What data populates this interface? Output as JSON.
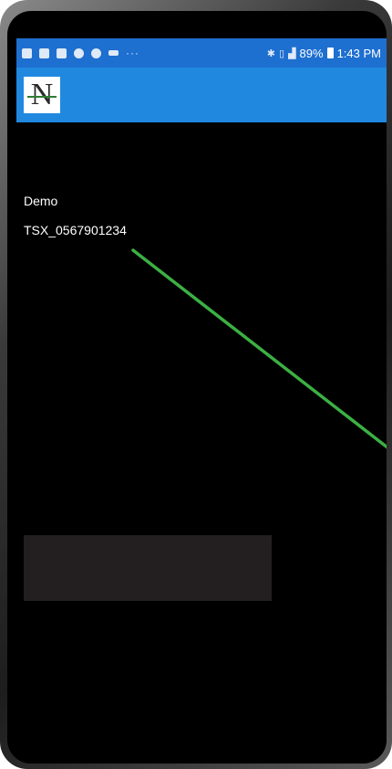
{
  "status_bar": {
    "battery": "89%",
    "time": "1:43 PM",
    "icons_left": [
      "flipboard-icon",
      "flipboard-icon",
      "message-icon",
      "chrome-icon",
      "app-icon",
      "photos-icon",
      "more-dots-icon"
    ],
    "icons_right": [
      "bluetooth-icon",
      "vibrate-icon",
      "signal-icon",
      "battery-icon"
    ],
    "more_dots": "···"
  },
  "app_bar": {
    "logo_text": "N",
    "color": "#2188e0"
  },
  "content": {
    "label": "Demo",
    "value": "TSX_0567901234"
  },
  "colors": {
    "screen_bg": "#000000",
    "status_bar": "#1d6fd0",
    "annotation_line": "#3cb043",
    "dark_box": "#231f20"
  }
}
